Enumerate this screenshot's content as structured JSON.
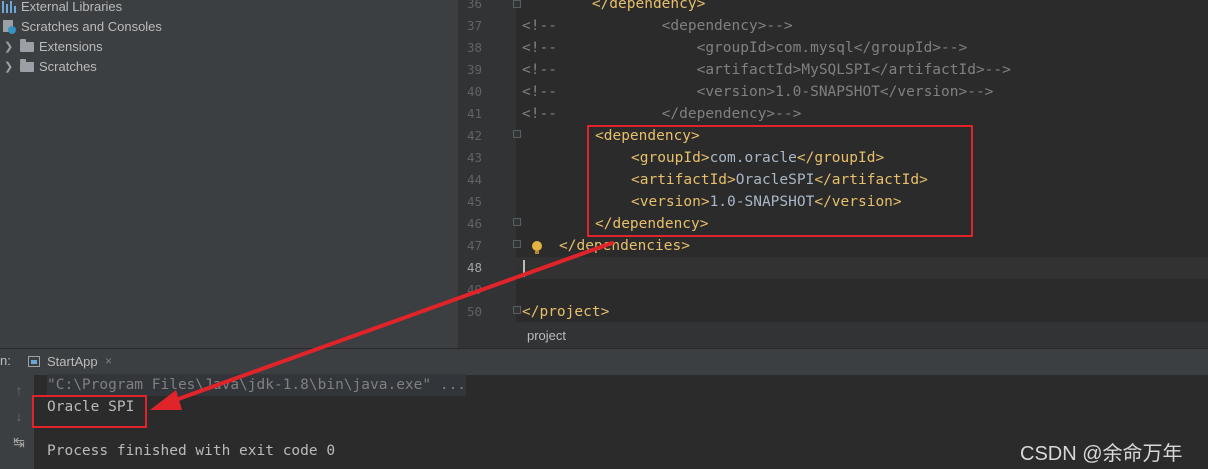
{
  "project_tree": {
    "items": [
      {
        "label": "External Libraries",
        "icon": "libraries-icon"
      },
      {
        "label": "Scratches and Consoles",
        "icon": "scratches-icon"
      },
      {
        "label": "Extensions",
        "icon": "folder-icon"
      },
      {
        "label": "Scratches",
        "icon": "folder-icon"
      }
    ]
  },
  "editor": {
    "line_numbers": [
      "36",
      "37",
      "38",
      "39",
      "40",
      "41",
      "42",
      "43",
      "44",
      "45",
      "46",
      "47",
      "48",
      "49",
      "50"
    ],
    "lines": [
      {
        "indent": "",
        "comment": "",
        "tag": "        </dependency>",
        "text": ""
      },
      {
        "comment": "<!--",
        "rest": "            <dependency>-->"
      },
      {
        "comment": "<!--",
        "rest": "                <groupId>com.mysql</groupId>-->"
      },
      {
        "comment": "<!--",
        "rest": "                <artifactId>MySQLSPI</artifactId>-->"
      },
      {
        "comment": "<!--",
        "rest": "                <version>1.0-SNAPSHOT</version>-->"
      },
      {
        "comment": "<!--",
        "rest": "            </dependency>-->"
      }
    ],
    "dependency_block": {
      "open": "<dependency>",
      "groupId_open": "<groupId>",
      "groupId": "com.oracle",
      "groupId_close": "</groupId>",
      "artifactId_open": "<artifactId>",
      "artifactId": "OracleSPI",
      "artifactId_close": "</artifactId>",
      "version_open": "<version>",
      "version": "1.0-SNAPSHOT",
      "version_close": "</version>",
      "close": "</dependency>"
    },
    "dependencies_close": "</dependencies>",
    "project_close": "</project>",
    "breadcrumb": "project"
  },
  "run_panel": {
    "label": "n:",
    "tab_label": "StartApp",
    "tab_close": "×",
    "command_line": "\"C:\\Program Files\\Java\\jdk-1.8\\bin\\java.exe\" ...",
    "output": "Oracle SPI",
    "exit_message": "Process finished with exit code 0"
  },
  "watermark": "CSDN @余命万年",
  "colors": {
    "annotation_red": "#e0242a",
    "tag": "#e8bf6a",
    "comment": "#808080"
  }
}
